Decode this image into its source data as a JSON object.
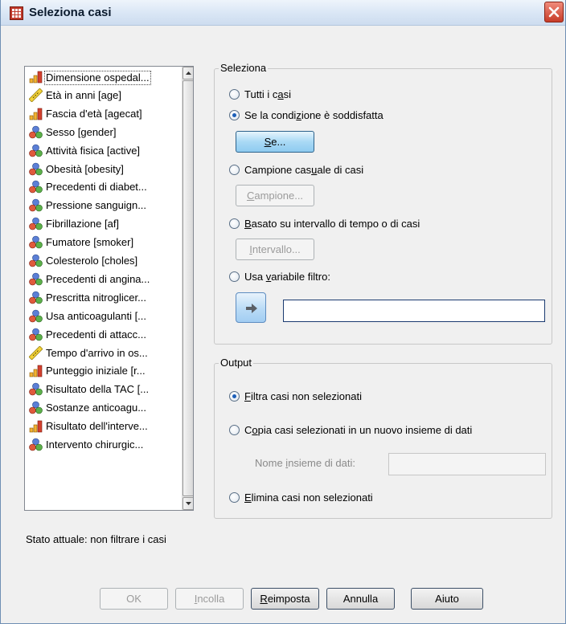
{
  "window": {
    "title": "Seleziona casi"
  },
  "variables": [
    {
      "label": "Dimensione ospedal...",
      "icon": "ordinal-bar-icon"
    },
    {
      "label": "Età in anni [age]",
      "icon": "scale-ruler-icon"
    },
    {
      "label": "Fascia d'età [agecat]",
      "icon": "ordinal-bar-icon"
    },
    {
      "label": "Sesso [gender]",
      "icon": "nominal-circles-icon"
    },
    {
      "label": "Attività fisica [active]",
      "icon": "nominal-circles-icon"
    },
    {
      "label": "Obesità [obesity]",
      "icon": "nominal-circles-icon"
    },
    {
      "label": "Precedenti di diabet...",
      "icon": "nominal-circles-icon"
    },
    {
      "label": "Pressione sanguign...",
      "icon": "nominal-circles-icon"
    },
    {
      "label": "Fibrillazione [af]",
      "icon": "nominal-circles-icon"
    },
    {
      "label": "Fumatore [smoker]",
      "icon": "nominal-circles-icon"
    },
    {
      "label": "Colesterolo [choles]",
      "icon": "nominal-circles-icon"
    },
    {
      "label": "Precedenti di angina...",
      "icon": "nominal-circles-icon"
    },
    {
      "label": "Prescritta nitroglicer...",
      "icon": "nominal-circles-icon"
    },
    {
      "label": "Usa anticoagulanti [...",
      "icon": "nominal-circles-icon"
    },
    {
      "label": "Precedenti di attacc...",
      "icon": "nominal-circles-icon"
    },
    {
      "label": "Tempo d'arrivo in os...",
      "icon": "scale-ruler-icon"
    },
    {
      "label": "Punteggio iniziale [r...",
      "icon": "ordinal-bar-icon"
    },
    {
      "label": "Risultato della TAC [...",
      "icon": "nominal-circles-icon"
    },
    {
      "label": "Sostanze anticoagu...",
      "icon": "nominal-circles-icon"
    },
    {
      "label": "Risultato dell'interve...",
      "icon": "ordinal-bar-icon"
    },
    {
      "label": "Intervento chirurgic...",
      "icon": "nominal-circles-icon"
    }
  ],
  "status_text": "Stato attuale: non filtrare i casi",
  "seleziona": {
    "legend": "Seleziona",
    "tutti": {
      "before": "Tutti i c",
      "key": "a",
      "after": "si"
    },
    "condizione": {
      "before": "Se la condi",
      "key": "z",
      "after": "ione è soddisfatta"
    },
    "se_button": {
      "before": "",
      "key": "S",
      "after": "e..."
    },
    "campione": {
      "before": "Campione cas",
      "key": "u",
      "after": "ale di casi"
    },
    "campione_button": {
      "before": "",
      "key": "C",
      "after": "ampione..."
    },
    "intervallo": {
      "before": "",
      "key": "B",
      "after": "asato su intervallo di tempo o di casi"
    },
    "intervallo_button": {
      "before": "",
      "key": "I",
      "after": "ntervallo..."
    },
    "filtro": {
      "before": "Usa ",
      "key": "v",
      "after": "ariabile filtro:"
    },
    "filtro_value": ""
  },
  "output": {
    "legend": "Output",
    "filtra": {
      "before": "",
      "key": "F",
      "after": "iltra casi non selezionati"
    },
    "copia": {
      "before": "C",
      "key": "o",
      "after": "pia casi selezionati in un nuovo insieme di dati"
    },
    "nome_label": {
      "before": "Nome ",
      "key": "i",
      "after": "nsieme di dati:"
    },
    "nome_value": "",
    "elimina": {
      "before": "",
      "key": "E",
      "after": "limina casi non selezionati"
    }
  },
  "buttons": {
    "ok": "OK",
    "incolla": {
      "before": "",
      "key": "I",
      "after": "ncolla"
    },
    "reimposta": {
      "before": "",
      "key": "R",
      "after": "eimposta"
    },
    "annulla": "Annulla",
    "aiuto": "Aiuto"
  },
  "colors": {
    "accent": "#1d5fb8",
    "titlebar": "#d9e6f5",
    "close": "#c73c28"
  }
}
